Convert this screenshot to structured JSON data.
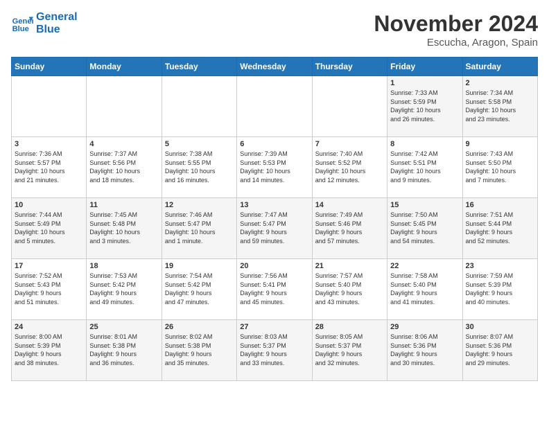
{
  "header": {
    "logo_line1": "General",
    "logo_line2": "Blue",
    "month": "November 2024",
    "location": "Escucha, Aragon, Spain"
  },
  "days_of_week": [
    "Sunday",
    "Monday",
    "Tuesday",
    "Wednesday",
    "Thursday",
    "Friday",
    "Saturday"
  ],
  "weeks": [
    [
      {
        "day": "",
        "detail": ""
      },
      {
        "day": "",
        "detail": ""
      },
      {
        "day": "",
        "detail": ""
      },
      {
        "day": "",
        "detail": ""
      },
      {
        "day": "",
        "detail": ""
      },
      {
        "day": "1",
        "detail": "Sunrise: 7:33 AM\nSunset: 5:59 PM\nDaylight: 10 hours\nand 26 minutes."
      },
      {
        "day": "2",
        "detail": "Sunrise: 7:34 AM\nSunset: 5:58 PM\nDaylight: 10 hours\nand 23 minutes."
      }
    ],
    [
      {
        "day": "3",
        "detail": "Sunrise: 7:36 AM\nSunset: 5:57 PM\nDaylight: 10 hours\nand 21 minutes."
      },
      {
        "day": "4",
        "detail": "Sunrise: 7:37 AM\nSunset: 5:56 PM\nDaylight: 10 hours\nand 18 minutes."
      },
      {
        "day": "5",
        "detail": "Sunrise: 7:38 AM\nSunset: 5:55 PM\nDaylight: 10 hours\nand 16 minutes."
      },
      {
        "day": "6",
        "detail": "Sunrise: 7:39 AM\nSunset: 5:53 PM\nDaylight: 10 hours\nand 14 minutes."
      },
      {
        "day": "7",
        "detail": "Sunrise: 7:40 AM\nSunset: 5:52 PM\nDaylight: 10 hours\nand 12 minutes."
      },
      {
        "day": "8",
        "detail": "Sunrise: 7:42 AM\nSunset: 5:51 PM\nDaylight: 10 hours\nand 9 minutes."
      },
      {
        "day": "9",
        "detail": "Sunrise: 7:43 AM\nSunset: 5:50 PM\nDaylight: 10 hours\nand 7 minutes."
      }
    ],
    [
      {
        "day": "10",
        "detail": "Sunrise: 7:44 AM\nSunset: 5:49 PM\nDaylight: 10 hours\nand 5 minutes."
      },
      {
        "day": "11",
        "detail": "Sunrise: 7:45 AM\nSunset: 5:48 PM\nDaylight: 10 hours\nand 3 minutes."
      },
      {
        "day": "12",
        "detail": "Sunrise: 7:46 AM\nSunset: 5:47 PM\nDaylight: 10 hours\nand 1 minute."
      },
      {
        "day": "13",
        "detail": "Sunrise: 7:47 AM\nSunset: 5:47 PM\nDaylight: 9 hours\nand 59 minutes."
      },
      {
        "day": "14",
        "detail": "Sunrise: 7:49 AM\nSunset: 5:46 PM\nDaylight: 9 hours\nand 57 minutes."
      },
      {
        "day": "15",
        "detail": "Sunrise: 7:50 AM\nSunset: 5:45 PM\nDaylight: 9 hours\nand 54 minutes."
      },
      {
        "day": "16",
        "detail": "Sunrise: 7:51 AM\nSunset: 5:44 PM\nDaylight: 9 hours\nand 52 minutes."
      }
    ],
    [
      {
        "day": "17",
        "detail": "Sunrise: 7:52 AM\nSunset: 5:43 PM\nDaylight: 9 hours\nand 51 minutes."
      },
      {
        "day": "18",
        "detail": "Sunrise: 7:53 AM\nSunset: 5:42 PM\nDaylight: 9 hours\nand 49 minutes."
      },
      {
        "day": "19",
        "detail": "Sunrise: 7:54 AM\nSunset: 5:42 PM\nDaylight: 9 hours\nand 47 minutes."
      },
      {
        "day": "20",
        "detail": "Sunrise: 7:56 AM\nSunset: 5:41 PM\nDaylight: 9 hours\nand 45 minutes."
      },
      {
        "day": "21",
        "detail": "Sunrise: 7:57 AM\nSunset: 5:40 PM\nDaylight: 9 hours\nand 43 minutes."
      },
      {
        "day": "22",
        "detail": "Sunrise: 7:58 AM\nSunset: 5:40 PM\nDaylight: 9 hours\nand 41 minutes."
      },
      {
        "day": "23",
        "detail": "Sunrise: 7:59 AM\nSunset: 5:39 PM\nDaylight: 9 hours\nand 40 minutes."
      }
    ],
    [
      {
        "day": "24",
        "detail": "Sunrise: 8:00 AM\nSunset: 5:39 PM\nDaylight: 9 hours\nand 38 minutes."
      },
      {
        "day": "25",
        "detail": "Sunrise: 8:01 AM\nSunset: 5:38 PM\nDaylight: 9 hours\nand 36 minutes."
      },
      {
        "day": "26",
        "detail": "Sunrise: 8:02 AM\nSunset: 5:38 PM\nDaylight: 9 hours\nand 35 minutes."
      },
      {
        "day": "27",
        "detail": "Sunrise: 8:03 AM\nSunset: 5:37 PM\nDaylight: 9 hours\nand 33 minutes."
      },
      {
        "day": "28",
        "detail": "Sunrise: 8:05 AM\nSunset: 5:37 PM\nDaylight: 9 hours\nand 32 minutes."
      },
      {
        "day": "29",
        "detail": "Sunrise: 8:06 AM\nSunset: 5:36 PM\nDaylight: 9 hours\nand 30 minutes."
      },
      {
        "day": "30",
        "detail": "Sunrise: 8:07 AM\nSunset: 5:36 PM\nDaylight: 9 hours\nand 29 minutes."
      }
    ]
  ]
}
